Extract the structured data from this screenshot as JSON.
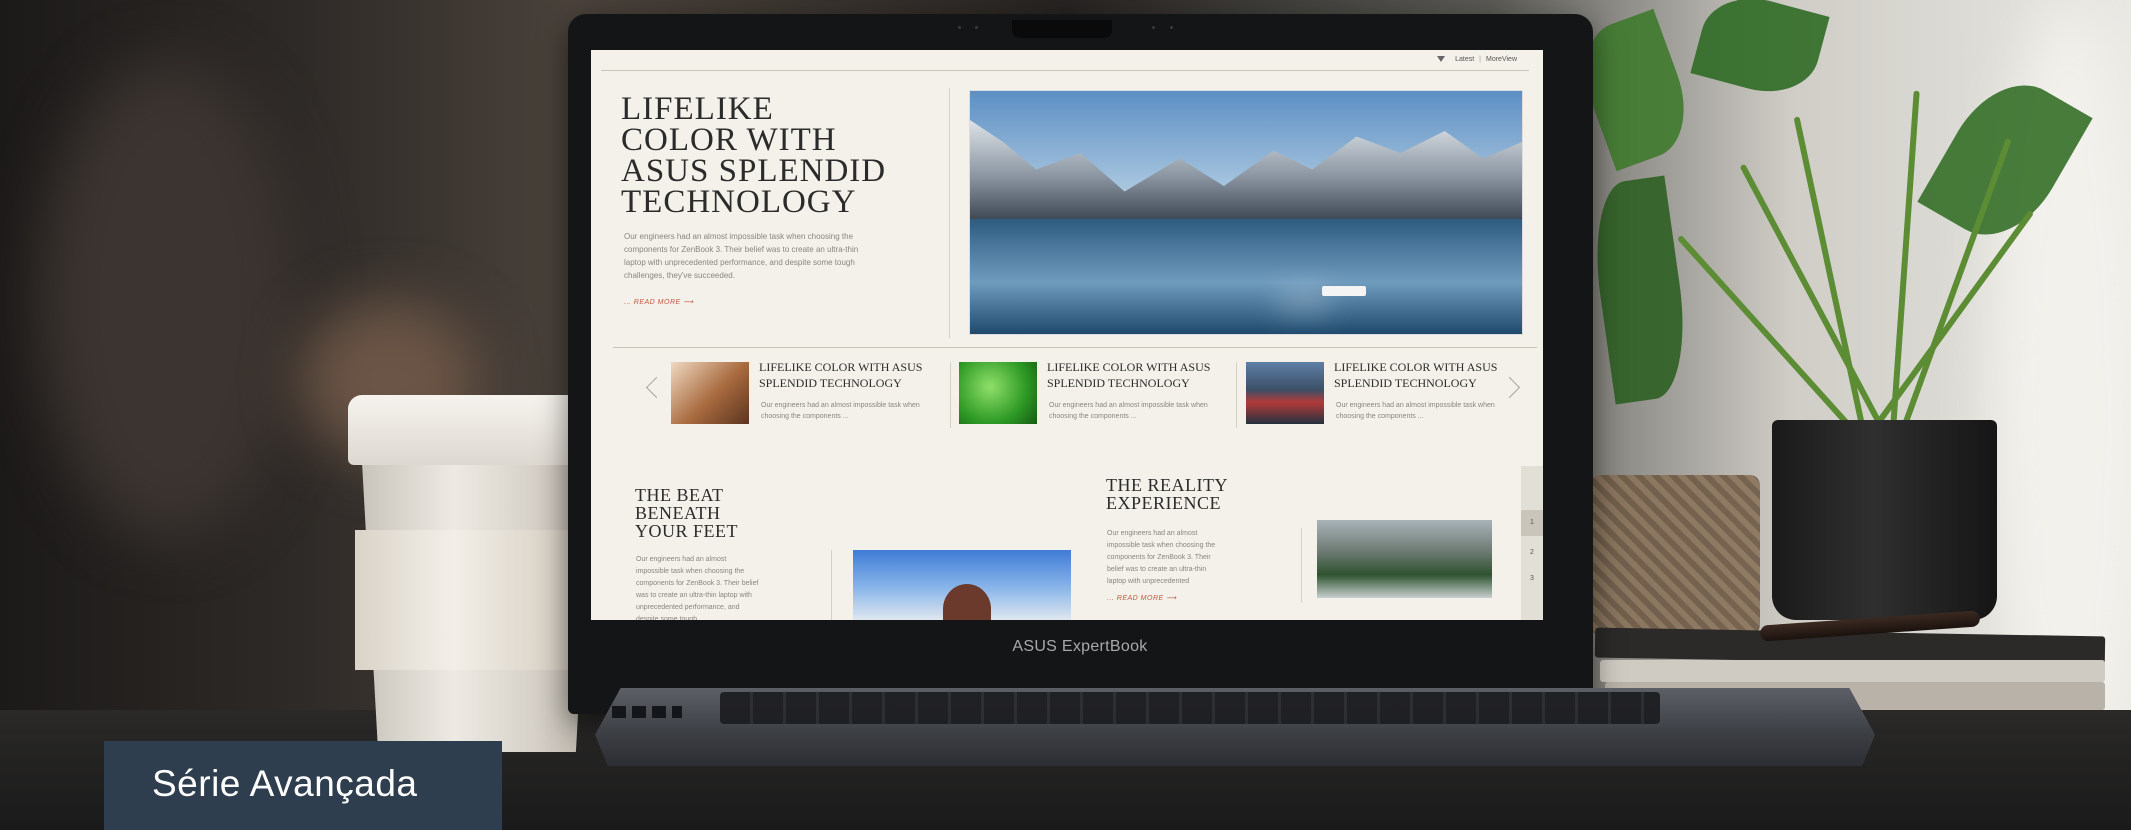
{
  "laptop": {
    "brand_label": "ASUS ExpertBook"
  },
  "screen_page": {
    "nav": {
      "latest_label": "Latest",
      "view_label": "MoreView"
    },
    "hero": {
      "title": "LIFELIKE COLOR WITH ASUS SPLENDID TECHNOLOGY",
      "body": "Our engineers had an almost impossible task when choosing the components for ZenBook 3. Their belief was to create an ultra-thin laptop with unprecedented performance, and despite some tough challenges, they've succeeded.",
      "read_more": "READ MORE"
    },
    "cards": [
      {
        "title": "LIFELIKE COLOR WITH ASUS SPLENDID TECHNOLOGY",
        "text": "Our engineers had an almost impossible task when choosing the components ..."
      },
      {
        "title": "LIFELIKE COLOR WITH ASUS SPLENDID TECHNOLOGY",
        "text": "Our engineers had an almost impossible task when choosing the components ..."
      },
      {
        "title": "LIFELIKE COLOR WITH ASUS SPLENDID TECHNOLOGY",
        "text": "Our engineers had an almost impossible task when choosing the components ..."
      }
    ],
    "section_left": {
      "title": "THE BEAT BENEATH YOUR FEET",
      "body": "Our engineers had an almost impossible task when choosing the components for ZenBook 3. Their belief was to create an ultra-thin laptop with unprecedented performance, and despite some tough"
    },
    "section_right": {
      "title": "THE REALITY EXPERIENCE",
      "body": "Our engineers had an almost impossible task when choosing the components for ZenBook 3. Their belief was to create an ultra-thin laptop with unprecedented",
      "read_more": "READ MORE"
    },
    "pager": [
      "1",
      "2",
      "3"
    ]
  },
  "caption": {
    "label": "Série Avançada",
    "background_color": "#2f3e4f"
  }
}
